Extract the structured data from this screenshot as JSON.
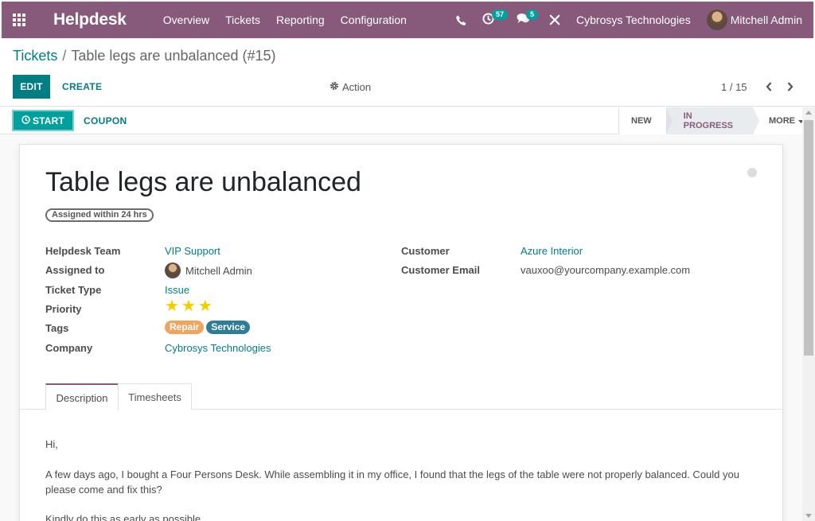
{
  "navbar": {
    "app_name": "Helpdesk",
    "menu": [
      "Overview",
      "Tickets",
      "Reporting",
      "Configuration"
    ],
    "activity_count": "57",
    "message_count": "5",
    "company": "Cybrosys Technologies",
    "user": "Mitchell Admin",
    "colors": {
      "brand": "#875a7b",
      "accent": "#00a09d"
    },
    "icons": [
      "apps-grid-icon",
      "phone-icon",
      "clock-icon",
      "chat-icon",
      "tools-icon"
    ]
  },
  "breadcrumb": {
    "parent": "Tickets",
    "separator": "/",
    "current": "Table legs are unbalanced (#15)"
  },
  "toolbar": {
    "edit": "EDIT",
    "create": "CREATE",
    "action": "Action",
    "pager": "1 / 15"
  },
  "statusbar": {
    "start": "START",
    "coupon": "COUPON",
    "stages": [
      "NEW",
      "IN PROGRESS",
      "MORE"
    ],
    "active_stage": "IN PROGRESS"
  },
  "ticket": {
    "title": "Table legs are unbalanced",
    "sla": "Assigned within 24 hrs",
    "fields": {
      "team": {
        "label": "Helpdesk Team",
        "value": "VIP Support"
      },
      "assigned": {
        "label": "Assigned to",
        "value": "Mitchell Admin"
      },
      "type": {
        "label": "Ticket Type",
        "value": "Issue"
      },
      "priority": {
        "label": "Priority",
        "stars": 3
      },
      "tags": {
        "label": "Tags",
        "values": [
          "Repair",
          "Service"
        ],
        "colors": [
          "#f0a35e",
          "#2f7d95"
        ]
      },
      "company": {
        "label": "Company",
        "value": "Cybrosys Technologies"
      },
      "customer": {
        "label": "Customer",
        "value": "Azure Interior"
      },
      "email": {
        "label": "Customer Email",
        "value": "vauxoo@yourcompany.example.com"
      }
    },
    "tabs": [
      "Description",
      "Timesheets"
    ],
    "active_tab": "Description",
    "description": [
      "Hi,",
      "A few days ago, I bought a Four Persons Desk. While assembling it in my office, I found that the legs of the table were not properly balanced. Could you please come and fix this?",
      "Kindly do this as early as possible."
    ]
  }
}
